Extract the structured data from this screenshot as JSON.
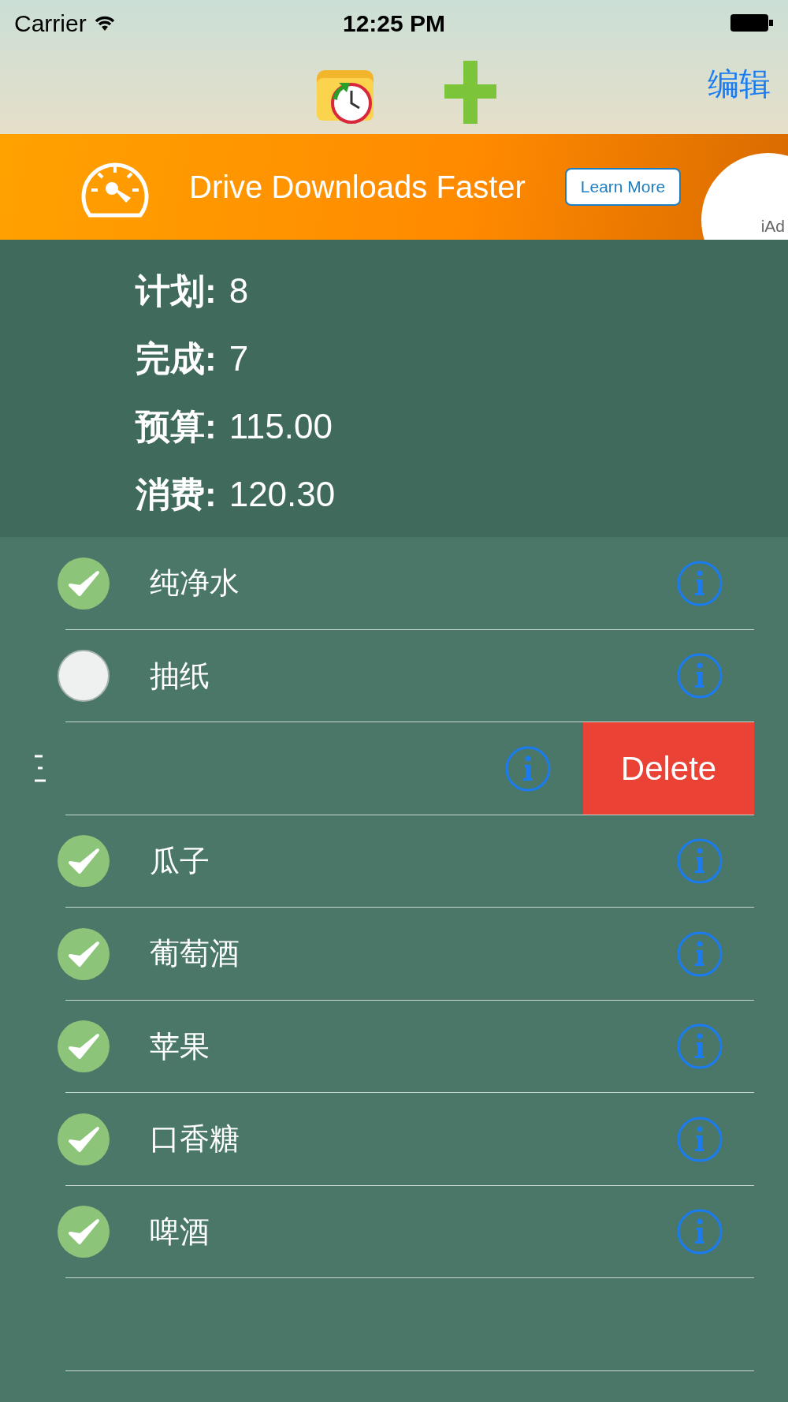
{
  "status_bar": {
    "carrier": "Carrier",
    "time": "12:25 PM"
  },
  "nav_bar": {
    "edit": "编辑"
  },
  "ad": {
    "headline": "Drive Downloads Faster",
    "button": "Learn More",
    "label": "iAd"
  },
  "summary": [
    {
      "label": "计划:",
      "value": "8"
    },
    {
      "label": "完成:",
      "value": "7"
    },
    {
      "label": "预算:",
      "value": "115.00"
    },
    {
      "label": "消费:",
      "value": "120.30"
    }
  ],
  "rows": [
    {
      "kind": "item",
      "name": "纯净水",
      "checked": true
    },
    {
      "kind": "item",
      "name": "抽纸",
      "checked": false
    },
    {
      "kind": "swiped",
      "action": "Delete"
    },
    {
      "kind": "item",
      "name": "瓜子",
      "checked": true
    },
    {
      "kind": "item",
      "name": "葡萄酒",
      "checked": true
    },
    {
      "kind": "item",
      "name": "苹果",
      "checked": true
    },
    {
      "kind": "item",
      "name": "口香糖",
      "checked": true
    },
    {
      "kind": "item",
      "name": "啤酒",
      "checked": true
    },
    {
      "kind": "empty"
    }
  ]
}
